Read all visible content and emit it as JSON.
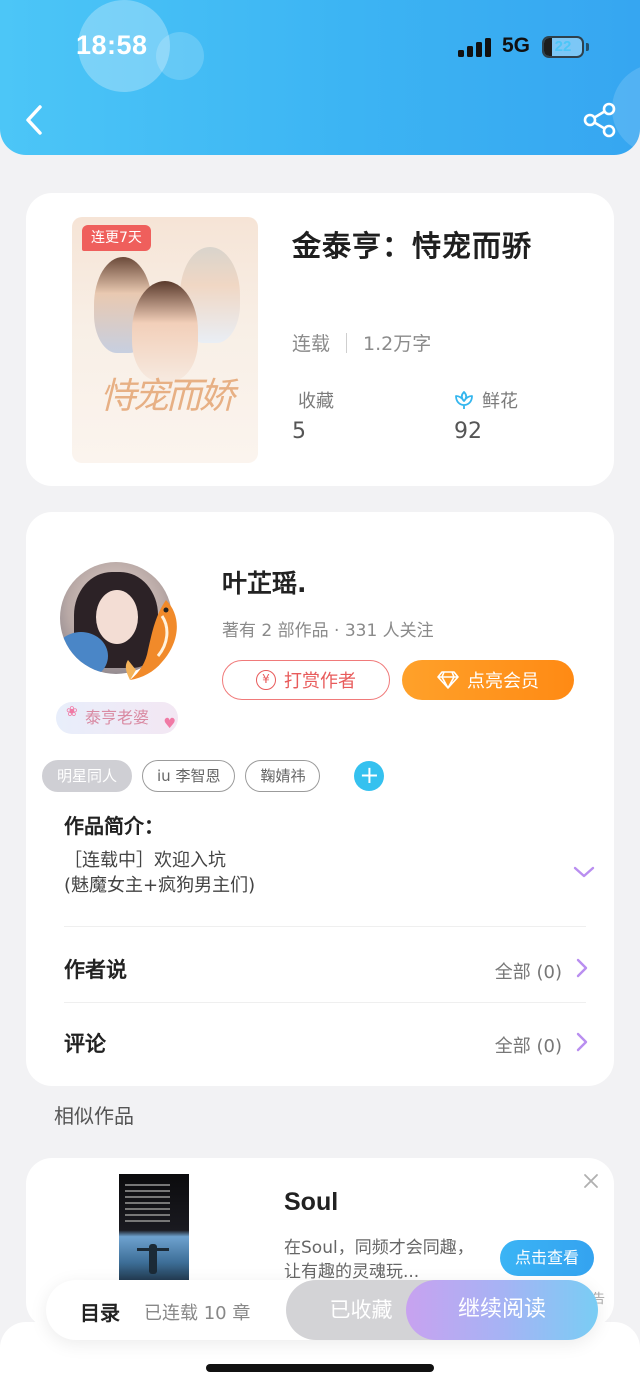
{
  "status_bar": {
    "time": "18:58",
    "network": "5G",
    "battery": "22",
    "battery_level": 0.22
  },
  "book": {
    "cover_tag": "连更7天",
    "cover_title_text": "恃宠而娇",
    "title": "金泰亨：恃宠而骄",
    "status": "连载",
    "word_count": "1.2万字",
    "favorites_label": "收藏",
    "favorites_value": "5",
    "flowers_label": "鲜花",
    "flowers_value": "92"
  },
  "author": {
    "name": "叶芷瑶.",
    "stats": "著有 2 部作品 · 331 人关注",
    "badge": "泰亨老婆",
    "tip_button": "打赏作者",
    "vip_button": "点亮会员",
    "tags": [
      "明星同人",
      "iu 李智恩",
      "鞠婧祎"
    ],
    "add_tag": "+"
  },
  "intro": {
    "title": "作品简介：",
    "text": "［连载中］欢迎入坑\n(魅魔女主+疯狗男主们)"
  },
  "rows": {
    "author_says_label": "作者说",
    "author_says_value": "全部 (0)",
    "comments_label": "评论",
    "comments_value": "全部 (0)"
  },
  "similar": {
    "section_title": "相似作品"
  },
  "ad": {
    "title": "Soul",
    "description": "在Soul，同频才会同趣，让有趣的灵魂玩...",
    "cta": "点击查看",
    "note": "告"
  },
  "bottom_bar": {
    "toc": "目录",
    "progress": "已连载 10 章",
    "favorited": "已收藏",
    "continue": "继续阅读"
  },
  "colors": {
    "header_gradient_start": "#4cc6f7",
    "header_gradient_end": "#36a6f1",
    "tip_red": "#e85b5b",
    "vip_orange": "#ff8a14",
    "accent_blue": "#35c1ef",
    "chevron_purple": "#b98ef0"
  }
}
